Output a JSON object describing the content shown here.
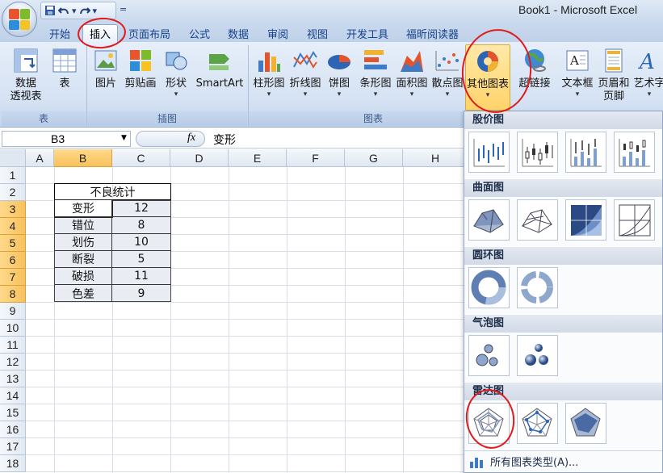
{
  "window": {
    "title": "Book1 - Microsoft Excel"
  },
  "qat": {
    "more_label": "="
  },
  "tabs": [
    {
      "label": "开始"
    },
    {
      "label": "插入"
    },
    {
      "label": "页面布局"
    },
    {
      "label": "公式"
    },
    {
      "label": "数据"
    },
    {
      "label": "审阅"
    },
    {
      "label": "视图"
    },
    {
      "label": "开发工具"
    },
    {
      "label": "福昕阅读器"
    }
  ],
  "ribbon": {
    "groups": [
      {
        "label": "表"
      },
      {
        "label": "插图"
      },
      {
        "label": "图表"
      }
    ],
    "buttons": {
      "pivot_line1": "数据",
      "pivot_line2": "透视表",
      "table": "表",
      "picture": "图片",
      "clipart": "剪贴画",
      "shapes": "形状",
      "smartart": "SmartArt",
      "column": "柱形图",
      "line": "折线图",
      "pie": "饼图",
      "bar": "条形图",
      "area": "面积图",
      "scatter": "散点图",
      "other": "其他图表",
      "hyperlink": "超链接",
      "textbox": "文本框",
      "header_line1": "页眉和",
      "header_line2": "页脚",
      "wordart": "艺术字",
      "dropdown_glyph": "▾"
    }
  },
  "formula_bar": {
    "name_box": "B3",
    "fx": "fx",
    "value": "变形"
  },
  "sheet": {
    "columns": [
      "A",
      "B",
      "C",
      "D",
      "E",
      "F",
      "G",
      "H"
    ],
    "rows": [
      "1",
      "2",
      "3",
      "4",
      "5",
      "6",
      "7",
      "8",
      "9",
      "10",
      "11",
      "12",
      "13",
      "14",
      "15",
      "16",
      "17",
      "18"
    ],
    "table_title": "不良统计",
    "data": [
      {
        "name": "变形",
        "value": "12"
      },
      {
        "name": "错位",
        "value": "8"
      },
      {
        "name": "划伤",
        "value": "10"
      },
      {
        "name": "断裂",
        "value": "5"
      },
      {
        "name": "破损",
        "value": "11"
      },
      {
        "name": "色差",
        "value": "9"
      }
    ]
  },
  "chart_menu": {
    "sections": [
      {
        "label": "股价图"
      },
      {
        "label": "曲面图"
      },
      {
        "label": "圆环图"
      },
      {
        "label": "气泡图"
      },
      {
        "label": "雷达图"
      }
    ],
    "all_types": "所有图表类型(A)..."
  },
  "colors": {
    "accent": "#15428b",
    "highlight": "#ffd36a",
    "annotation": "#e01a1a"
  }
}
